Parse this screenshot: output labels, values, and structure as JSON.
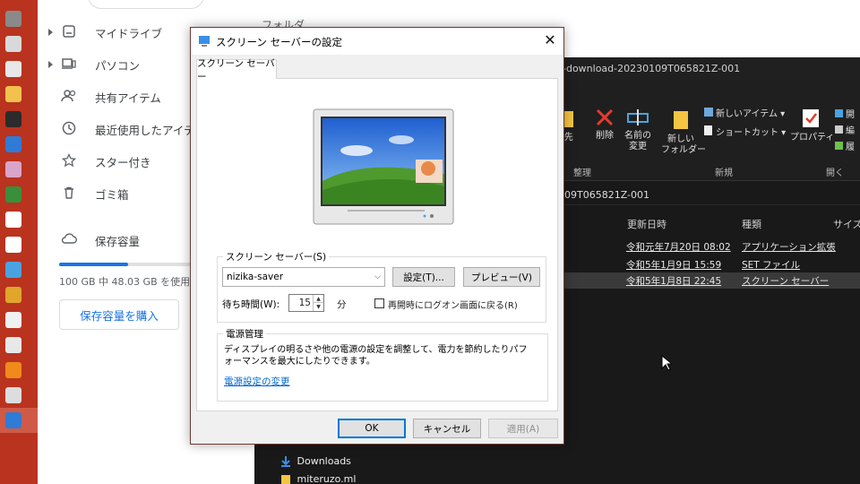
{
  "taskbar": {
    "icons": [
      {
        "name": "chrome-icon",
        "color": "#8a8a8a"
      },
      {
        "name": "network-icon",
        "color": "#d9d9d9"
      },
      {
        "name": "mail-icon",
        "color": "#e8e8e8"
      },
      {
        "name": "character-app-icon",
        "color": "#f2c14e"
      },
      {
        "name": "film-icon",
        "color": "#2b2b2b"
      },
      {
        "name": "monitor-app-icon",
        "color": "#2f7bd6"
      },
      {
        "name": "photo-app-icon",
        "color": "#d9a5c9"
      },
      {
        "name": "green-app-icon",
        "color": "#3a8f3a"
      },
      {
        "name": "cube-app-icon",
        "color": "#ffffff"
      },
      {
        "name": "printer-app-icon",
        "color": "#ffffff"
      },
      {
        "name": "window-app-icon",
        "color": "#4aa3e0"
      },
      {
        "name": "colorful-app-icon",
        "color": "#e0a52a"
      },
      {
        "name": "music-app-icon",
        "color": "#f0f0f0"
      },
      {
        "name": "folder-app-icon",
        "color": "#e8e8e8"
      },
      {
        "name": "orange-app-icon",
        "color": "#f08a1c"
      },
      {
        "name": "pen-app-icon",
        "color": "#dddddd"
      },
      {
        "name": "screensaver-app-icon",
        "color": "#2f7bd6"
      }
    ]
  },
  "drive": {
    "folder_label": "フォルダ",
    "nav": [
      {
        "label": "マイドライブ",
        "icon": "drive-icon"
      },
      {
        "label": "パソコン",
        "icon": "computer-icon"
      },
      {
        "label": "共有アイテム",
        "icon": "shared-people-icon"
      },
      {
        "label": "最近使用したアイテ",
        "icon": "clock-icon"
      },
      {
        "label": "スター付き",
        "icon": "star-icon"
      },
      {
        "label": "ゴミ箱",
        "icon": "trash-icon"
      },
      {
        "label": "保存容量",
        "icon": "cloud-icon"
      }
    ],
    "storage_text": "100 GB 中 48.03 GB を使用",
    "storage_fraction": 0.48,
    "buy_button": "保存容量を購入"
  },
  "explorer": {
    "title": "-download-20230109T065821Z-001",
    "path": "09T065821Z-001",
    "ribbon": {
      "buttons": [
        "-先",
        "削除",
        "名前の\n変更",
        "新しい\nフォルダー",
        "新しいアイテム ▾",
        "ショートカット ▾",
        "プロパティ",
        "開",
        "編",
        "履"
      ],
      "groups": [
        "整理",
        "新規",
        "開く"
      ]
    },
    "columns": [
      "更新日時",
      "種類",
      "サイズ"
    ],
    "rows": [
      {
        "date": "令和元年7月20日 08:02",
        "type": "アプリケーション拡張"
      },
      {
        "date": "令和5年1月9日 15:59",
        "type": "SET ファイル"
      },
      {
        "date": "令和5年1月8日 22:45",
        "type": "スクリーン セーバー"
      }
    ],
    "nav_items": [
      "Downloads",
      "miteruzo.ml"
    ]
  },
  "dialog": {
    "title": "スクリーン セーバーの設定",
    "close": "✕",
    "tab": "スクリーン セーバー",
    "screensaver_group": "スクリーン セーバー(S)",
    "selected_saver": "nizika-saver",
    "settings_button": "設定(T)...",
    "preview_button": "プレビュー(V)",
    "wait_label": "待ち時間(W):",
    "wait_value": "15",
    "wait_unit": "分",
    "logon_checkbox": "再開時にログオン画面に戻る(R)",
    "logon_checked": false,
    "power_group": "電源管理",
    "power_text": "ディスプレイの明るさや他の電源の設定を調整して、電力を節約したりパフォーマンスを最大にしたりできます。",
    "power_link": "電源設定の変更",
    "ok_button": "OK",
    "cancel_button": "キャンセル",
    "apply_button": "適用(A)"
  }
}
